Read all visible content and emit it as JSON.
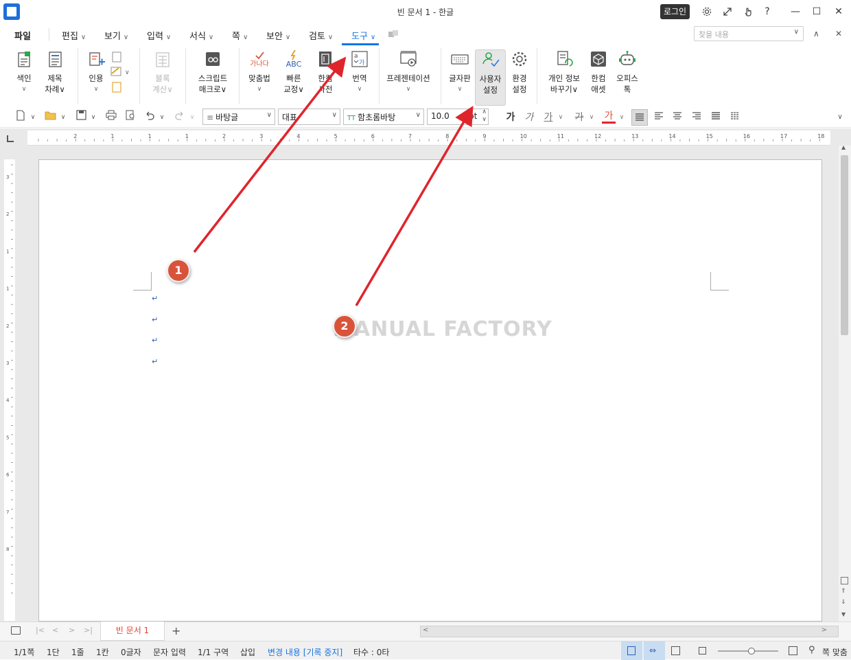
{
  "window": {
    "title": "빈 문서 1 - 한글",
    "login_label": "로그인",
    "settings_icon": "gear-icon",
    "restore_icon": "expand-icon",
    "touch_icon": "hand-icon",
    "help_label": "?",
    "minimize": "—",
    "maximize": "☐",
    "close": "✕"
  },
  "menu": {
    "file": "파일",
    "items": [
      {
        "label": "편집",
        "chevron": "∨"
      },
      {
        "label": "보기",
        "chevron": "∨"
      },
      {
        "label": "입력",
        "chevron": "∨"
      },
      {
        "label": "서식",
        "chevron": "∨"
      },
      {
        "label": "쪽",
        "chevron": "∨"
      },
      {
        "label": "보안",
        "chevron": "∨"
      },
      {
        "label": "검토",
        "chevron": "∨"
      },
      {
        "label": "도구",
        "chevron": "∨"
      }
    ],
    "search_placeholder": "찾을 내용",
    "collapse": "∧",
    "close": "✕"
  },
  "ribbon": {
    "index": {
      "l1": "색인",
      "ch": "∨"
    },
    "toc": {
      "l1": "제목",
      "l2": "차례∨"
    },
    "cite": {
      "l1": "인용",
      "ch": "∨"
    },
    "block": {
      "l1": "블록",
      "l2": "계산∨"
    },
    "script": {
      "l1": "스크립트",
      "l2": "매크로∨"
    },
    "spell": {
      "icon_text": "가나다",
      "l1": "맞춤법",
      "ch": "∨"
    },
    "quick": {
      "icon_text": "ABC",
      "l1": "빠른",
      "l2": "교정∨"
    },
    "dict": {
      "l1": "한컴",
      "l2": "사전"
    },
    "translate": {
      "l1": "번역",
      "ch": "∨"
    },
    "present": {
      "l1": "프레젠테이션",
      "ch": "∨"
    },
    "keyboard": {
      "l1": "글자판",
      "ch": "∨"
    },
    "user": {
      "l1": "사용자",
      "l2": "설정"
    },
    "env": {
      "l1": "환경",
      "l2": "설정"
    },
    "privacy": {
      "l1": "개인 정보",
      "l2": "바꾸기∨"
    },
    "asset": {
      "l1": "한컴",
      "l2": "애셋"
    },
    "office": {
      "l1": "오피스",
      "l2": "톡"
    }
  },
  "format": {
    "style": "바탕글",
    "lang": "대표",
    "font": "함초롬바탕",
    "font_icon": "TT",
    "size": "10.0",
    "unit": "pt",
    "bold": "가",
    "italic": "가",
    "underline": "가",
    "strike": "가",
    "color": "가",
    "expand": "∨"
  },
  "ruler": {
    "h": [
      "2",
      "1",
      "1",
      "1",
      "2",
      "3",
      "4",
      "5",
      "6",
      "7",
      "8",
      "9",
      "10",
      "11",
      "12",
      "13",
      "14",
      "15",
      "16",
      "17",
      "18"
    ],
    "v": [
      "3",
      "2",
      "1",
      "1",
      "2",
      "3",
      "4",
      "5",
      "6",
      "7",
      "8"
    ]
  },
  "document": {
    "para_mark": "↵",
    "watermark": "MANUAL FACTORY"
  },
  "annotations": {
    "b1": "1",
    "b2": "2"
  },
  "tabs": {
    "doc": "빈 문서 1",
    "add": "+",
    "nav": [
      "|<",
      "<",
      ">",
      ">|"
    ]
  },
  "status": {
    "page": "1/1쪽",
    "col": "1단",
    "line": "1줄",
    "cell": "1칸",
    "chars": "0글자",
    "mode": "문자 입력",
    "section": "1/1 구역",
    "insert": "삽입",
    "track": "변경 내용 [기록 중지]",
    "typing": "타수 : 0타",
    "fit": "쪽 맞춤"
  },
  "colors": {
    "accent": "#1473e6",
    "arrow": "#e0242c",
    "badge": "#d9533b",
    "doctab": "#e0422d"
  }
}
